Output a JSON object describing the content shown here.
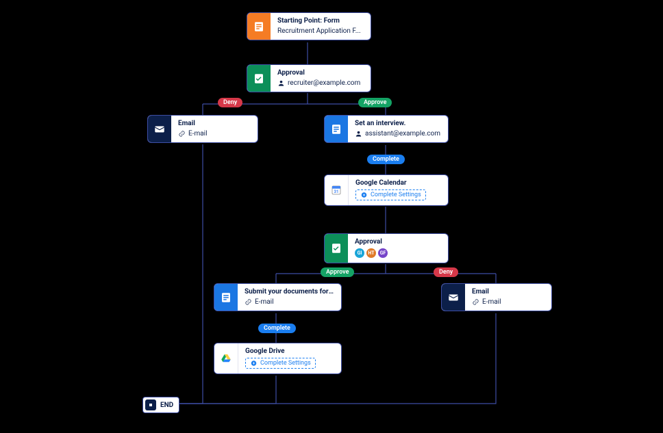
{
  "nodes": {
    "start": {
      "title": "Starting Point: Form",
      "sub": "Recruitment Application F..."
    },
    "appr1": {
      "title": "Approval",
      "sub": "recruiter@example.com"
    },
    "email_deny1": {
      "title": "Email",
      "sub": "E-mail"
    },
    "interview": {
      "title": "Set an interview.",
      "sub": "assistant@example.com"
    },
    "gcal": {
      "title": "Google Calendar"
    },
    "appr2": {
      "title": "Approval"
    },
    "submit": {
      "title": "Submit your documents for o...",
      "sub": "E-mail"
    },
    "gdrive": {
      "title": "Google Drive"
    },
    "email_deny2": {
      "title": "Email",
      "sub": "E-mail"
    },
    "end": {
      "label": "END"
    }
  },
  "pills": {
    "deny": "Deny",
    "approve": "Approve",
    "complete": "Complete"
  },
  "buttons": {
    "complete_settings": "Complete Settings"
  },
  "avatars": [
    "GI",
    "HT",
    "GF"
  ]
}
